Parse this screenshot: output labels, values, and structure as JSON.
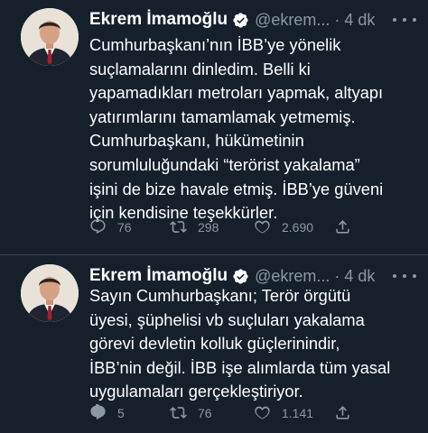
{
  "tweets": [
    {
      "author_name": "Ekrem İmamoğlu",
      "handle": "@ekrem...",
      "separator": "·",
      "time": "4 dk",
      "lines": [
        "Cumhurbaşkanı’nın İBB’ye yönelik",
        "suçlamalarını dinledim. Belli ki",
        "yapamadıkları metroları yapmak, altyapı",
        "yatırımlarını tamamlamak yetmemiş.",
        "Cumhurbaşkanı, hükümetinin",
        "sorumluluğundaki “terörist yakalama”",
        "işini de bize havale etmiş. İBB’ye güveni",
        "için kendisine teşekkürler."
      ],
      "replies": "76",
      "retweets": "298",
      "likes": "2.690"
    },
    {
      "author_name": "Ekrem İmamoğlu",
      "handle": "@ekrem...",
      "separator": "·",
      "time": "4 dk",
      "lines": [
        "Sayın Cumhurbaşkanı; Terör örgütü",
        "üyesi, şüphelisi vb suçluları yakalama",
        "görevi devletin kolluk güçlerinindir,",
        "İBB’nin değil. İBB işe alımlarda tüm yasal",
        "uygulamaları gerçekleştiriyor."
      ],
      "replies": "5",
      "retweets": "76",
      "likes": "1.141"
    }
  ],
  "icons": {
    "verified": "verified-badge-icon",
    "more": "more-options-icon",
    "reply": "reply-icon",
    "retweet": "retweet-icon",
    "like": "like-heart-icon",
    "share": "share-icon"
  },
  "colors": {
    "background": "#15202b",
    "text": "#ffffff",
    "muted": "#8b98a5",
    "divider": "#38444d"
  }
}
